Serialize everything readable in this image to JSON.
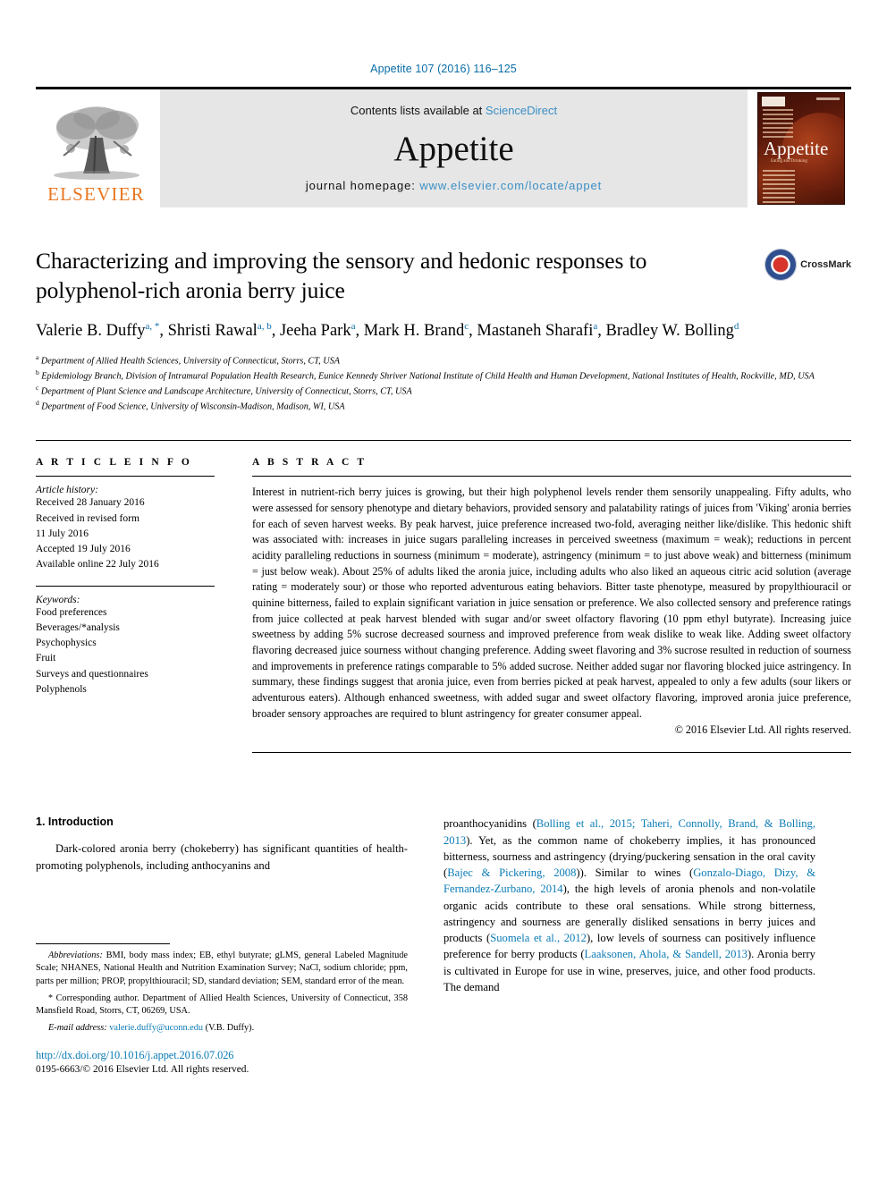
{
  "running_head": "Appetite 107 (2016) 116–125",
  "banner": {
    "publisher_name": "ELSEVIER",
    "contents_prefix": "Contents lists available at ",
    "contents_link": "ScienceDirect",
    "journal_name": "Appetite",
    "homepage_label": "journal homepage: ",
    "homepage_url": "www.elsevier.com/locate/appet",
    "cover_title": "Appetite",
    "cover_subtitle": "Eating and Drinking"
  },
  "article": {
    "title": "Characterizing and improving the sensory and hedonic responses to polyphenol-rich aronia berry juice",
    "crossmark_label": "CrossMark",
    "authors_line1": "Valerie B. Duffy",
    "authors": [
      {
        "name": "Valerie B. Duffy",
        "marks": "a, *"
      },
      {
        "name": "Shristi Rawal",
        "marks": "a, b"
      },
      {
        "name": "Jeeha Park",
        "marks": "a"
      },
      {
        "name": "Mark H. Brand",
        "marks": "c"
      },
      {
        "name": "Mastaneh Sharafi",
        "marks": "a"
      },
      {
        "name": "Bradley W. Bolling",
        "marks": "d"
      }
    ],
    "affiliations": [
      {
        "mark": "a",
        "text": "Department of Allied Health Sciences, University of Connecticut, Storrs, CT, USA"
      },
      {
        "mark": "b",
        "text": "Epidemiology Branch, Division of Intramural Population Health Research, Eunice Kennedy Shriver National Institute of Child Health and Human Development, National Institutes of Health, Rockville, MD, USA"
      },
      {
        "mark": "c",
        "text": "Department of Plant Science and Landscape Architecture, University of Connecticut, Storrs, CT, USA"
      },
      {
        "mark": "d",
        "text": "Department of Food Science, University of Wisconsin-Madison, Madison, WI, USA"
      }
    ]
  },
  "article_info": {
    "heading": "A R T I C L E   I N F O",
    "history_label": "Article history:",
    "history": [
      "Received 28 January 2016",
      "Received in revised form",
      "11 July 2016",
      "Accepted 19 July 2016",
      "Available online 22 July 2016"
    ],
    "keywords_label": "Keywords:",
    "keywords": [
      "Food preferences",
      "Beverages/*analysis",
      "Psychophysics",
      "Fruit",
      "Surveys and questionnaires",
      "Polyphenols"
    ]
  },
  "abstract": {
    "heading": "A B S T R A C T",
    "text": "Interest in nutrient-rich berry juices is growing, but their high polyphenol levels render them sensorily unappealing. Fifty adults, who were assessed for sensory phenotype and dietary behaviors, provided sensory and palatability ratings of juices from 'Viking' aronia berries for each of seven harvest weeks. By peak harvest, juice preference increased two-fold, averaging neither like/dislike. This hedonic shift was associated with: increases in juice sugars paralleling increases in perceived sweetness (maximum = weak); reductions in percent acidity paralleling reductions in sourness (minimum = moderate), astringency (minimum = to just above weak) and bitterness (minimum = just below weak). About 25% of adults liked the aronia juice, including adults who also liked an aqueous citric acid solution (average rating = moderately sour) or those who reported adventurous eating behaviors. Bitter taste phenotype, measured by propylthiouracil or quinine bitterness, failed to explain significant variation in juice sensation or preference. We also collected sensory and preference ratings from juice collected at peak harvest blended with sugar and/or sweet olfactory flavoring (10 ppm ethyl butyrate). Increasing juice sweetness by adding 5% sucrose decreased sourness and improved preference from weak dislike to weak like. Adding sweet olfactory flavoring decreased juice sourness without changing preference. Adding sweet flavoring and 3% sucrose resulted in reduction of sourness and improvements in preference ratings comparable to 5% added sucrose. Neither added sugar nor flavoring blocked juice astringency. In summary, these findings suggest that aronia juice, even from berries picked at peak harvest, appealed to only a few adults (sour likers or adventurous eaters). Although enhanced sweetness, with added sugar and sweet olfactory flavoring, improved aronia juice preference, broader sensory approaches are required to blunt astringency for greater consumer appeal.",
    "copyright": "© 2016 Elsevier Ltd. All rights reserved."
  },
  "body": {
    "section_number_title": "1.  Introduction",
    "left_paragraph": "Dark-colored aronia berry (chokeberry) has significant quantities of health-promoting polyphenols, including anthocyanins and",
    "right_column": {
      "lead": "proanthocyanidins (",
      "cite1": "Bolling et al., 2015; Taheri, Connolly, Brand, & Bolling, 2013",
      "mid1": "). Yet, as the common name of chokeberry implies, it has pronounced bitterness, sourness and astringency (drying/puckering sensation in the oral cavity (",
      "cite2": "Bajec & Pickering, 2008",
      "mid2": ")). Similar to wines (",
      "cite3": "Gonzalo-Diago, Dizy, & Fernandez-Zurbano, 2014",
      "mid3": "), the high levels of aronia phenols and non-volatile organic acids contribute to these oral sensations. While strong bitterness, astringency and sourness are generally disliked sensations in berry juices and products (",
      "cite4": "Suomela et al., 2012",
      "mid4": "), low levels of sourness can positively influence preference for berry products (",
      "cite5": "Laaksonen, Ahola, & Sandell, 2013",
      "mid5": "). Aronia berry is cultivated in Europe for use in wine, preserves, juice, and other food products. The demand"
    }
  },
  "footnotes": {
    "abbreviations_label": "Abbreviations:",
    "abbreviations_text": " BMI, body mass index; EB, ethyl butyrate; gLMS, general Labeled Magnitude Scale; NHANES, National Health and Nutrition Examination Survey; NaCl, sodium chloride; ppm, parts per million; PROP, propylthiouracil; SD, standard deviation; SEM, standard error of the mean.",
    "corresponding_star": "*",
    "corresponding_text": " Corresponding author. Department of Allied Health Sciences, University of Connecticut, 358 Mansfield Road, Storrs, CT, 06269, USA.",
    "email_label": "E-mail address:",
    "email": "valerie.duffy@uconn.edu",
    "email_suffix": " (V.B. Duffy).",
    "doi_url": "http://dx.doi.org/10.1016/j.appet.2016.07.026",
    "issn_line": "0195-6663/© 2016 Elsevier Ltd. All rights reserved."
  },
  "colors": {
    "link_blue": "#0b7bb5",
    "header_blue": "#0b6ea8",
    "elsevier_orange": "#e87722",
    "banner_grey": "#e6e6e6"
  }
}
